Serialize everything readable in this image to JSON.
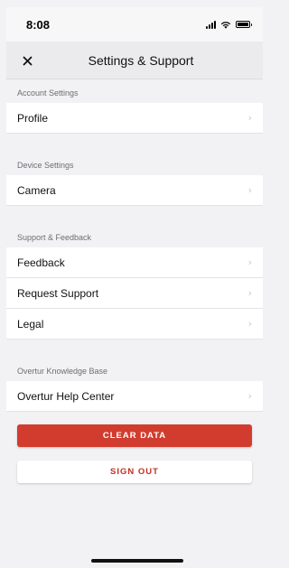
{
  "status_bar": {
    "time": "8:08",
    "icons": [
      "signal-icon",
      "wifi-icon",
      "battery-icon"
    ]
  },
  "nav": {
    "title": "Settings & Support",
    "close_icon": "close-icon"
  },
  "sections": [
    {
      "header": "Account Settings",
      "items": [
        {
          "label": "Profile"
        }
      ]
    },
    {
      "header": "Device Settings",
      "items": [
        {
          "label": "Camera"
        }
      ]
    },
    {
      "header": "Support & Feedback",
      "items": [
        {
          "label": "Feedback"
        },
        {
          "label": "Request Support"
        },
        {
          "label": "Legal"
        }
      ]
    },
    {
      "header": "Overtur Knowledge Base",
      "items": [
        {
          "label": "Overtur Help Center"
        }
      ]
    }
  ],
  "buttons": {
    "clear_data": "CLEAR DATA",
    "sign_out": "SIGN OUT"
  },
  "colors": {
    "accent_red": "#d23c2e",
    "sign_out_text": "#c42f24",
    "background": "#f2f2f4"
  }
}
